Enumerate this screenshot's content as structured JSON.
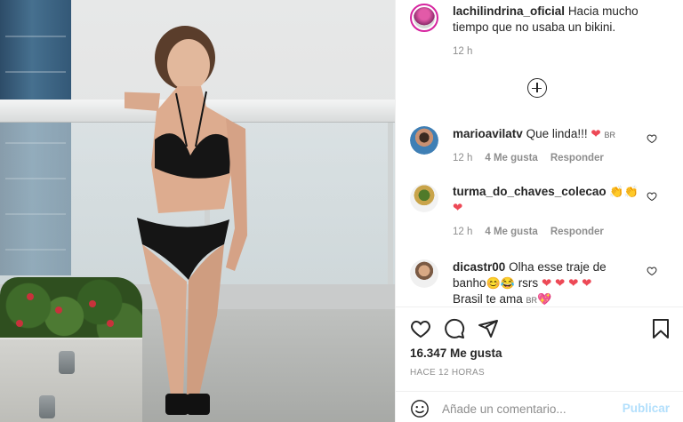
{
  "post": {
    "author": "lachilindrina_oficial",
    "caption": "Hacia mucho tiempo que no usaba un bikini.",
    "caption_time": "12 h",
    "load_more_icon": "plus-circle-icon"
  },
  "comments": [
    {
      "user": "marioavilatv",
      "text": "Que linda!!!",
      "suffix": "BR",
      "emoji": "❤",
      "time": "12 h",
      "likes": "4 Me gusta",
      "reply": "Responder"
    },
    {
      "user": "turma_do_chaves_colecao",
      "text": "",
      "emoji": "👏👏",
      "emoji_line2": "❤",
      "time": "12 h",
      "likes": "4 Me gusta",
      "reply": "Responder"
    },
    {
      "user": "dicastr00",
      "text_line1": "Olha esse traje de",
      "text_line2a": "banho",
      "emoji_line2": "😊😂",
      "text_line2b": "rsrs",
      "hearts_line2": "❤ ❤ ❤ ❤",
      "text_line3": "Brasil te ama",
      "suffix_line3": "BR",
      "emoji_line3": "💖"
    }
  ],
  "actions": {
    "likes_count": "16.347 Me gusta",
    "timestamp": "HACE 12 HORAS",
    "icons": [
      "heart-icon",
      "comment-icon",
      "share-icon",
      "bookmark-icon"
    ]
  },
  "composer": {
    "placeholder": "Añade un comentario...",
    "post_label": "Publicar"
  },
  "colors": {
    "accent_disabled": "#b2dffc",
    "like_red": "#ed4956",
    "muted": "#8e8e8e",
    "text": "#262626"
  }
}
